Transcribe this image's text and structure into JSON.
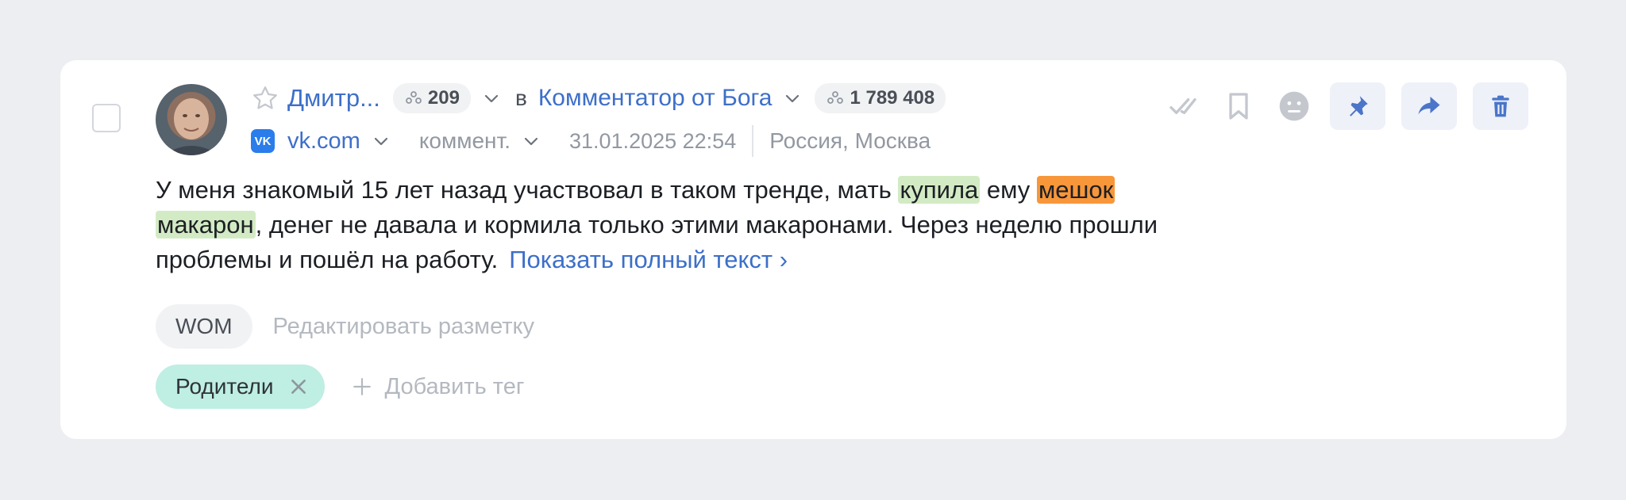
{
  "post": {
    "author": "Дмитр...",
    "author_followers": "209",
    "in_label": "в",
    "group": "Комментатор от Бога",
    "group_followers": "1 789 408",
    "site": "vk.com",
    "site_icon_text": "VK",
    "type": "коммент.",
    "date": "31.01.2025 22:54",
    "location": "Россия, Москва",
    "text_parts": {
      "p1": "У меня знакомый 15 лет назад участвовал в таком тренде, мать ",
      "h1": "купила",
      "p2": " ему ",
      "h2": "мешок",
      "p3": " ",
      "h3": "макарон",
      "p4": ", денег не давала и кормила только этими макаронами. Через неделю прошли проблемы и пошёл на работу."
    },
    "show_more": "Показать полный текст ›",
    "markup_chip": "WOM",
    "edit_markup": "Редактировать разметку",
    "tag": "Родители",
    "add_tag": "Добавить тег"
  },
  "colors": {
    "link": "#3d6fc9",
    "highlight_green": "#d3ebc4",
    "highlight_orange": "#f8963a",
    "tag_teal": "#bfeee3",
    "action_icon": "#4a75c9",
    "muted_icon": "#c4c8ce"
  },
  "icons": {
    "actions": [
      "check-icon",
      "bookmark-icon",
      "neutral-face-icon",
      "pin-icon",
      "share-icon",
      "trash-icon"
    ]
  }
}
